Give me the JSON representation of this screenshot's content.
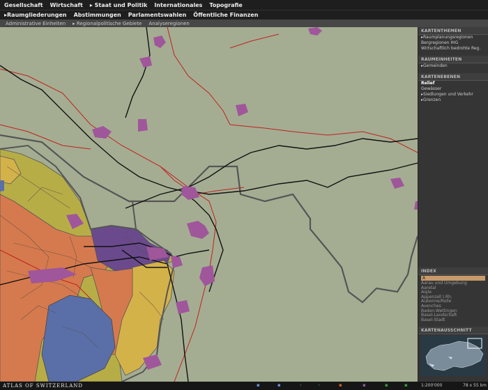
{
  "menu": {
    "top": [
      "Gesellschaft",
      "Wirtschaft",
      "Staat und Politik",
      "Internationales",
      "Topografie"
    ],
    "second": [
      "Raumgliederungen",
      "Abstimmungen",
      "Parlamentswahlen",
      "Öffentliche Finanzen"
    ],
    "third": [
      "Administrative Einheiten",
      "Regionalpolitische Gebiete",
      "Analyseregionen"
    ]
  },
  "panel": {
    "kartenthemen": {
      "title": "KARTENTHEMEN",
      "items": [
        "Raumplanungsregionen",
        "Bergregionen IHG",
        "Wirtschaftlich bedrohte Reg."
      ]
    },
    "raumeinheiten": {
      "title": "RAUMEINHEITEN",
      "items": [
        "Gemeinden"
      ]
    },
    "kartenebenen": {
      "title": "KARTENEBENEN",
      "items": [
        "Relief",
        "Gewässer",
        "Siedlungen und Verkehr",
        "Grenzen"
      ]
    },
    "index": {
      "title": "INDEX",
      "current": "A",
      "items": [
        "Aarau und Umgebung",
        "Aaretal",
        "Aigle",
        "Appenzell I.Rh.",
        "Aubonne/Rolle",
        "Avenches",
        "Baden-Wettingen",
        "Basel-Landschaft",
        "Basel-Stadt"
      ]
    },
    "ausschnitt": {
      "title": "KARTENAUSSCHNITT"
    }
  },
  "footer": {
    "logo": "ATLAS OF SWITZERLAND",
    "scale": "1:200'000",
    "dims": "78 x 55 km"
  },
  "colors": {
    "map_bg": "#a4ad92",
    "settlement": "#a0569a",
    "orange_region": "#d57a4e",
    "blue_region": "#5a6fa8",
    "yellow_region": "#d4b24a",
    "olive_region": "#b7ad47",
    "purple_region": "#6a4a8c"
  }
}
